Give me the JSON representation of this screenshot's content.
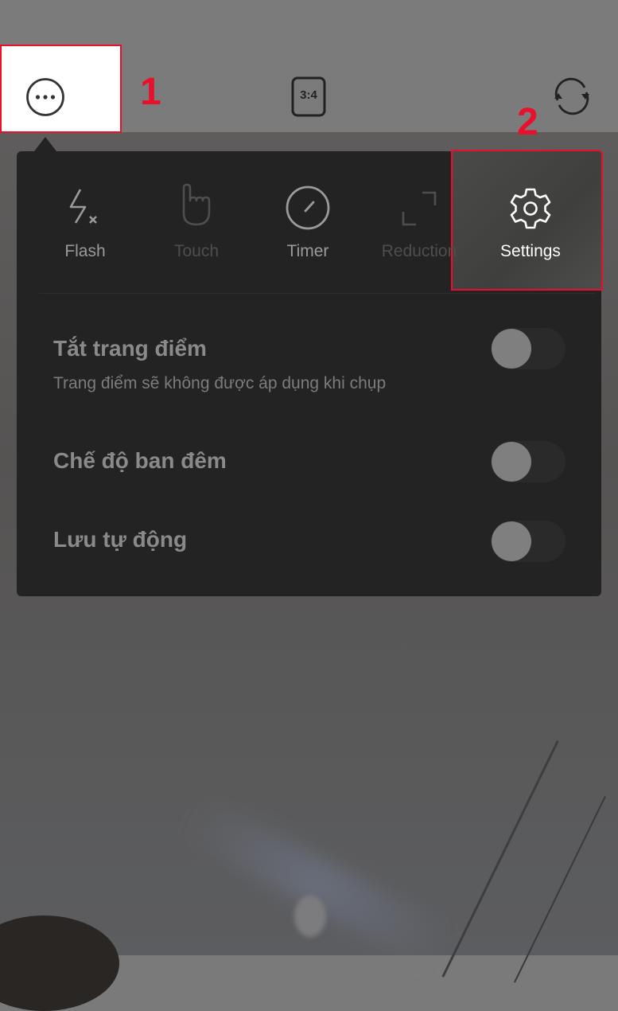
{
  "top_bar": {
    "more_icon": "more-horizontal-circle-icon",
    "aspect_ratio_label": "3:4",
    "switch_camera_icon": "camera-flip-icon"
  },
  "annotations": {
    "step1": "1",
    "step2": "2",
    "highlight_color": "#e8102a"
  },
  "quick_settings": [
    {
      "label": "Flash",
      "icon": "flash-off-icon",
      "state": "enabled",
      "color": "#9a9a9a"
    },
    {
      "label": "Touch",
      "icon": "touch-hand-icon",
      "state": "disabled",
      "color": "#4e4e4e"
    },
    {
      "label": "Timer",
      "icon": "timer-icon",
      "state": "enabled",
      "color": "#9a9a9a"
    },
    {
      "label": "Reduction",
      "icon": "reduction-expand-icon",
      "state": "disabled",
      "color": "#4e4e4e"
    },
    {
      "label": "Settings",
      "icon": "gear-icon",
      "state": "highlighted",
      "color": "#ffffff"
    }
  ],
  "toggles": [
    {
      "title": "Tắt trang điểm",
      "subtitle": "Trang điểm sẽ không được áp dụng khi chụp",
      "on": false
    },
    {
      "title": "Chế độ ban đêm",
      "subtitle": "",
      "on": false
    },
    {
      "title": "Lưu tự động",
      "subtitle": "",
      "on": false
    }
  ]
}
